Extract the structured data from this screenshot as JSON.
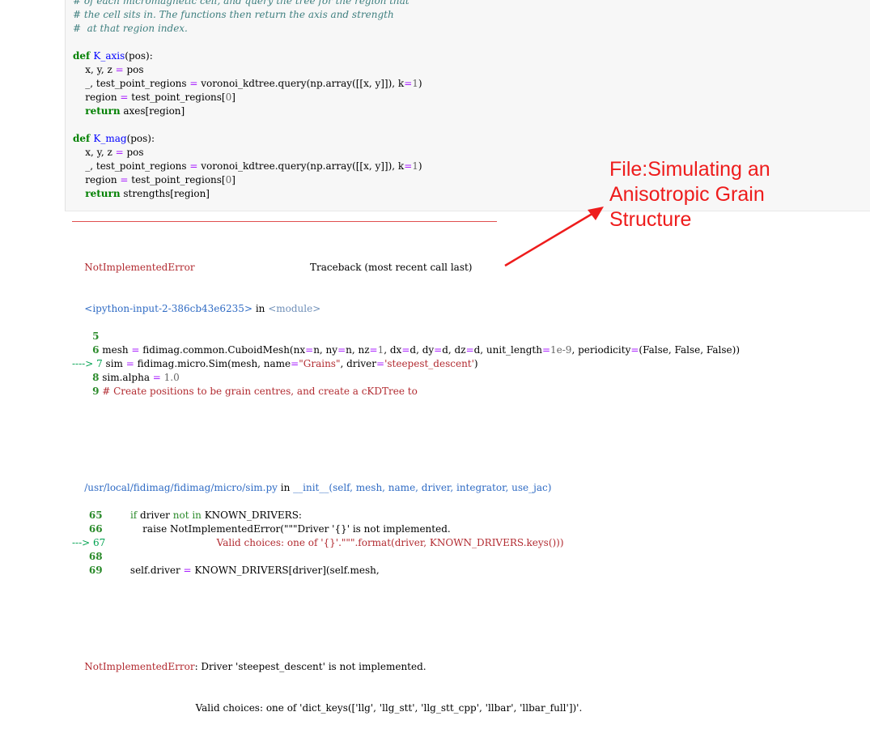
{
  "code_cell": {
    "lines": [
      [
        {
          "t": "# of each micromagnetic cell, and query the tree for the region that",
          "c": "cm"
        }
      ],
      [
        {
          "t": "# the cell sits in. The functions then return the axis and strength",
          "c": "cm"
        }
      ],
      [
        {
          "t": "#  at that region index.",
          "c": "cm"
        }
      ],
      [
        {
          "t": "",
          "c": ""
        }
      ],
      [
        {
          "t": "def ",
          "c": "kw"
        },
        {
          "t": "K_axis",
          "c": "fn"
        },
        {
          "t": "(pos):",
          "c": ""
        }
      ],
      [
        {
          "t": "    x, y, z ",
          "c": ""
        },
        {
          "t": "=",
          "c": "op"
        },
        {
          "t": " pos",
          "c": ""
        }
      ],
      [
        {
          "t": "    _, test_point_regions ",
          "c": ""
        },
        {
          "t": "=",
          "c": "op"
        },
        {
          "t": " voronoi_kdtree.query(np.array([[x, y]]), k",
          "c": ""
        },
        {
          "t": "=",
          "c": "op"
        },
        {
          "t": "1",
          "c": "num"
        },
        {
          "t": ")",
          "c": ""
        }
      ],
      [
        {
          "t": "    region ",
          "c": ""
        },
        {
          "t": "=",
          "c": "op"
        },
        {
          "t": " test_point_regions[",
          "c": ""
        },
        {
          "t": "0",
          "c": "num"
        },
        {
          "t": "]",
          "c": ""
        }
      ],
      [
        {
          "t": "    ",
          "c": ""
        },
        {
          "t": "return",
          "c": "kw"
        },
        {
          "t": " axes[region]",
          "c": ""
        }
      ],
      [
        {
          "t": "",
          "c": ""
        }
      ],
      [
        {
          "t": "def ",
          "c": "kw"
        },
        {
          "t": "K_mag",
          "c": "fn"
        },
        {
          "t": "(pos):",
          "c": ""
        }
      ],
      [
        {
          "t": "    x, y, z ",
          "c": ""
        },
        {
          "t": "=",
          "c": "op"
        },
        {
          "t": " pos",
          "c": ""
        }
      ],
      [
        {
          "t": "    _, test_point_regions ",
          "c": ""
        },
        {
          "t": "=",
          "c": "op"
        },
        {
          "t": " voronoi_kdtree.query(np.array([[x, y]]), k",
          "c": ""
        },
        {
          "t": "=",
          "c": "op"
        },
        {
          "t": "1",
          "c": "num"
        },
        {
          "t": ")",
          "c": ""
        }
      ],
      [
        {
          "t": "    region ",
          "c": ""
        },
        {
          "t": "=",
          "c": "op"
        },
        {
          "t": " test_point_regions[",
          "c": ""
        },
        {
          "t": "0",
          "c": "num"
        },
        {
          "t": "]",
          "c": ""
        }
      ],
      [
        {
          "t": "    ",
          "c": ""
        },
        {
          "t": "return",
          "c": "kw"
        },
        {
          "t": " strengths[region]",
          "c": ""
        }
      ]
    ]
  },
  "traceback": {
    "error_name": "NotImplementedError",
    "header_right": "Traceback (most recent call last)",
    "frame1_location": "<ipython-input-2-386cb43e6235>",
    "frame1_in": " in ",
    "frame1_module": "<module>",
    "frame1_lines": [
      [
        {
          "t": "      5",
          "c": "lineno"
        }
      ],
      [
        {
          "t": "      6",
          "c": "lineno"
        },
        {
          "t": " mesh ",
          "c": ""
        },
        {
          "t": "=",
          "c": "op"
        },
        {
          "t": " fidimag.common.CuboidMesh(nx",
          "c": ""
        },
        {
          "t": "=",
          "c": "op"
        },
        {
          "t": "n, ny",
          "c": ""
        },
        {
          "t": "=",
          "c": "op"
        },
        {
          "t": "n, nz",
          "c": ""
        },
        {
          "t": "=",
          "c": "op"
        },
        {
          "t": "1",
          "c": "num"
        },
        {
          "t": ", dx",
          "c": ""
        },
        {
          "t": "=",
          "c": "op"
        },
        {
          "t": "d, dy",
          "c": ""
        },
        {
          "t": "=",
          "c": "op"
        },
        {
          "t": "d, dz",
          "c": ""
        },
        {
          "t": "=",
          "c": "op"
        },
        {
          "t": "d, unit_length",
          "c": ""
        },
        {
          "t": "=",
          "c": "op"
        },
        {
          "t": "1e-9",
          "c": "num"
        },
        {
          "t": ", periodicity",
          "c": ""
        },
        {
          "t": "=",
          "c": "op"
        },
        {
          "t": "(False, False, False))",
          "c": ""
        }
      ],
      [
        {
          "t": "----> 7",
          "c": "green"
        },
        {
          "t": " sim ",
          "c": ""
        },
        {
          "t": "=",
          "c": "op"
        },
        {
          "t": " fidimag.micro.Sim(mesh, name",
          "c": ""
        },
        {
          "t": "=",
          "c": "op"
        },
        {
          "t": "\"Grains\"",
          "c": "string"
        },
        {
          "t": ", driver",
          "c": ""
        },
        {
          "t": "=",
          "c": "op"
        },
        {
          "t": "'steepest_descent'",
          "c": "string"
        },
        {
          "t": ")",
          "c": ""
        }
      ],
      [
        {
          "t": "      8",
          "c": "lineno"
        },
        {
          "t": " sim.alpha ",
          "c": ""
        },
        {
          "t": "=",
          "c": "op"
        },
        {
          "t": " 1.0",
          "c": "num"
        }
      ],
      [
        {
          "t": "      9",
          "c": "lineno"
        },
        {
          "t": " # Create positions to be grain centres, and create a cKDTree to",
          "c": "string"
        }
      ]
    ],
    "frame2_location": "/usr/local/fidimag/fidimag/micro/sim.py",
    "frame2_in": " in ",
    "frame2_func": "__init__(self, mesh, name, driver, integrator, use_jac)",
    "frame2_lines": [
      [
        {
          "t": "     65",
          "c": "lineno"
        },
        {
          "t": "         ",
          "c": ""
        },
        {
          "t": "if",
          "c": "pk"
        },
        {
          "t": " driver ",
          "c": ""
        },
        {
          "t": "not in",
          "c": "pk"
        },
        {
          "t": " KNOWN_DRIVERS:",
          "c": ""
        }
      ],
      [
        {
          "t": "     66",
          "c": "lineno"
        },
        {
          "t": "             raise NotImplementedError(\"\"\"Driver '{}' is not implemented.",
          "c": ""
        }
      ],
      [
        {
          "t": "---> 67",
          "c": "green"
        },
        {
          "t": "                                    Valid choices: one of '{}'.\"\"\".format(driver, KNOWN_DRIVERS.keys()))",
          "c": "string"
        }
      ],
      [
        {
          "t": "     68",
          "c": "lineno"
        }
      ],
      [
        {
          "t": "     69",
          "c": "lineno"
        },
        {
          "t": "         self.driver ",
          "c": ""
        },
        {
          "t": "=",
          "c": "op"
        },
        {
          "t": " KNOWN_DRIVERS[driver](self.mesh,",
          "c": ""
        }
      ]
    ],
    "final_error_name": "NotImplementedError",
    "final_message": ": Driver 'steepest_descent' is not implemented.",
    "final_message_2": "                                    Valid choices: one of 'dict_keys(['llg', 'llg_stt', 'llg_stt_cpp', 'llbar', 'llbar_full'])'."
  },
  "annotation": {
    "text": "File:Simulating an Anisotropic Grain Structure",
    "color": "#ee1c1c"
  }
}
